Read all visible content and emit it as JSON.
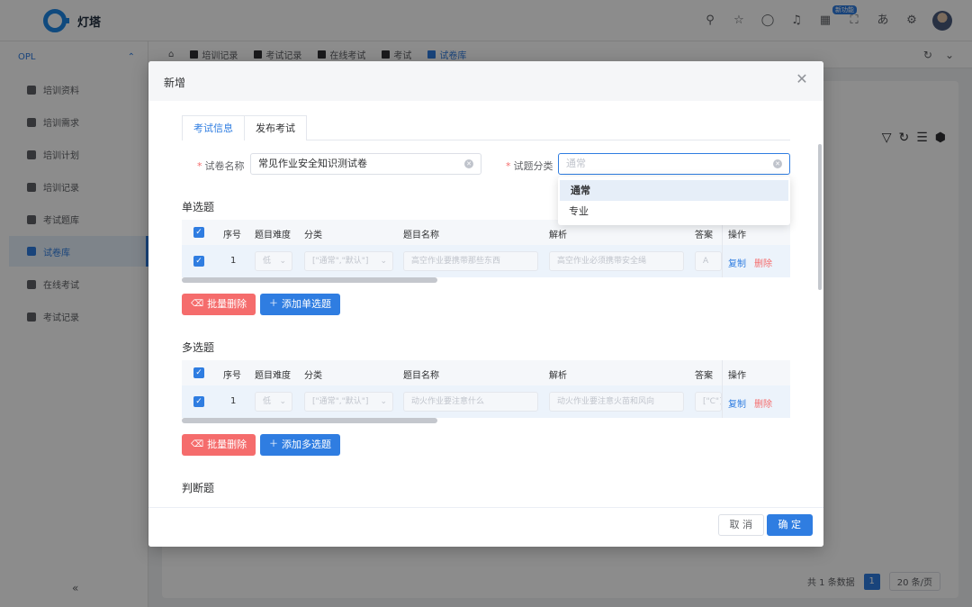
{
  "app": {
    "logo_text": "灯塔",
    "header_badge": "新功能"
  },
  "sidebar": {
    "group": "OPL",
    "items": [
      {
        "label": "培训资料"
      },
      {
        "label": "培训需求"
      },
      {
        "label": "培训计划"
      },
      {
        "label": "培训记录"
      },
      {
        "label": "考试题库"
      },
      {
        "label": "试卷库"
      },
      {
        "label": "在线考试"
      },
      {
        "label": "考试记录"
      }
    ],
    "collapse": "«"
  },
  "tabs": [
    {
      "label": "培训记录"
    },
    {
      "label": "考试记录"
    },
    {
      "label": "在线考试"
    },
    {
      "label": "考试"
    },
    {
      "label": "试卷库"
    }
  ],
  "pager": {
    "total": "共 1 条数据",
    "page": "1",
    "size": "20 条/页"
  },
  "dialog": {
    "title": "新增",
    "form_tabs": [
      "考试信息",
      "发布考试"
    ],
    "paper_name_label": "试卷名称",
    "paper_name_value": "常见作业安全知识测试卷",
    "category_label": "试题分类",
    "category_placeholder": "通常",
    "dropdown_options": [
      "通常",
      "专业"
    ],
    "single": {
      "title": "单选题",
      "headers": [
        "序号",
        "题目难度",
        "分类",
        "题目名称",
        "解析",
        "答案",
        "操作"
      ],
      "row": {
        "index": "1",
        "difficulty": "低",
        "category": "[\"通常\",\"默认\"]",
        "name": "高空作业要携带那些东西",
        "analysis": "高空作业必须携带安全绳",
        "answer": "A",
        "copy": "复制",
        "delete": "删除"
      },
      "batch_delete": "批量删除",
      "add": "添加单选题"
    },
    "multi": {
      "title": "多选题",
      "headers": [
        "序号",
        "题目难度",
        "分类",
        "题目名称",
        "解析",
        "答案",
        "操作"
      ],
      "row": {
        "index": "1",
        "difficulty": "低",
        "category": "[\"通常\",\"默认\"]",
        "name": "动火作业要注意什么",
        "analysis": "动火作业要注意火苗和风向",
        "answer": "[\"C\"]",
        "copy": "复制",
        "delete": "删除"
      },
      "batch_delete": "批量删除",
      "add": "添加多选题"
    },
    "judge_title": "判断题",
    "cancel": "取 消",
    "confirm": "确 定"
  }
}
